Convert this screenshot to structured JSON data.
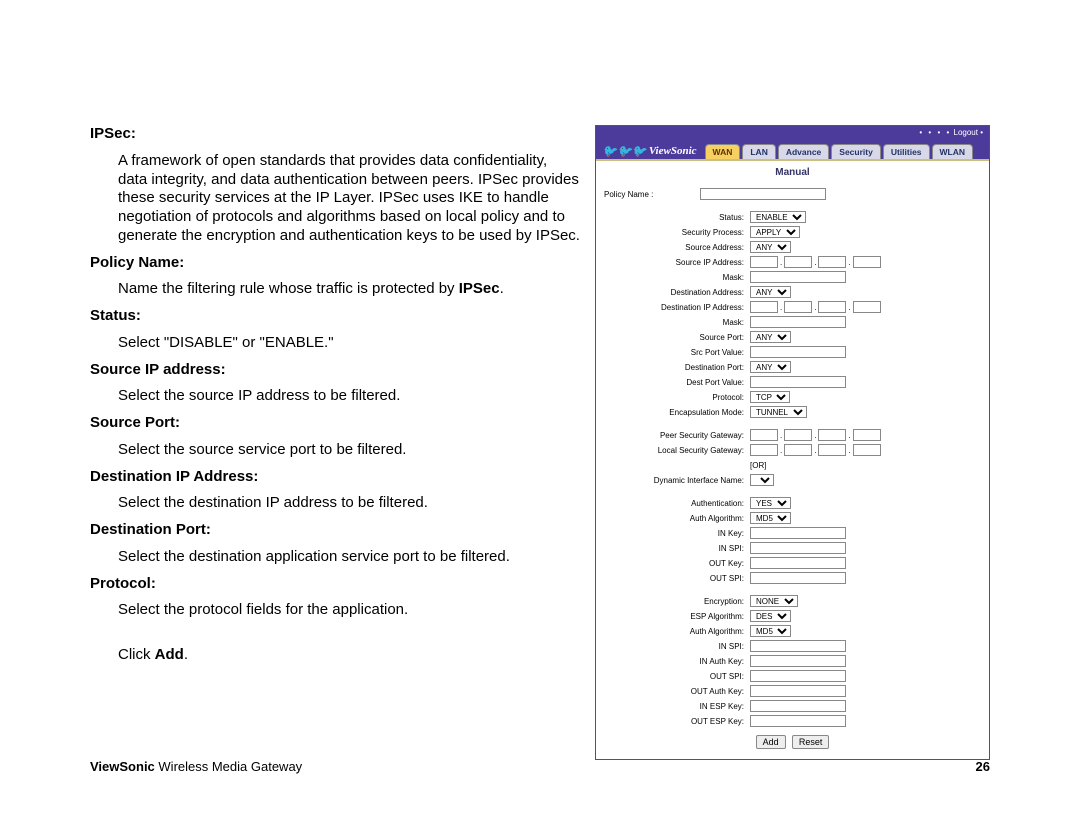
{
  "doc": {
    "sections": [
      {
        "heading": "IPSec:",
        "body": "A framework of open standards that provides data confidentiality, data integrity, and data authentication between peers.  IPSec provides these security services at the IP Layer.  IPSec uses IKE to handle negotiation of protocols and algorithms based on local policy and to generate the encryption and authentication keys to be used by IPSec."
      },
      {
        "heading": "Policy Name:",
        "body_pre": "Name the filtering rule whose traffic is protected by ",
        "body_bold": "IPSec",
        "body_post": "."
      },
      {
        "heading": "Status:",
        "body": "Select \"DISABLE\" or \"ENABLE.\""
      },
      {
        "heading": "Source IP address:",
        "body": "Select the source IP address to be filtered."
      },
      {
        "heading": "Source Port:",
        "body": "Select the source service port to be filtered."
      },
      {
        "heading": "Destination IP Address:",
        "body": "Select the destination IP address to be filtered."
      },
      {
        "heading": "Destination Port:",
        "body": "Select the destination application service port to be filtered."
      },
      {
        "heading": "Protocol:",
        "body": "Select the protocol fields for the application."
      }
    ],
    "click_pre": "Click ",
    "click_bold": "Add",
    "click_post": "."
  },
  "ui": {
    "logout": "Logout",
    "brand": "ViewSonic",
    "tabs": [
      "WAN",
      "LAN",
      "Advance",
      "Security",
      "Utilities",
      "WLAN"
    ],
    "title": "Manual",
    "policy_name_lbl": "Policy Name :",
    "rows1": [
      {
        "lbl": "Status:",
        "type": "select",
        "val": "ENABLE"
      },
      {
        "lbl": "Security Process:",
        "type": "select",
        "val": "APPLY"
      },
      {
        "lbl": "Source Address:",
        "type": "select",
        "val": "ANY"
      },
      {
        "lbl": "Source IP Address:",
        "type": "ip"
      },
      {
        "lbl": "Mask:",
        "type": "input_med"
      },
      {
        "lbl": "Destination Address:",
        "type": "select",
        "val": "ANY"
      },
      {
        "lbl": "Destination IP Address:",
        "type": "ip"
      },
      {
        "lbl": "Mask:",
        "type": "input_med"
      },
      {
        "lbl": "Source Port:",
        "type": "select",
        "val": "ANY"
      },
      {
        "lbl": "Src Port Value:",
        "type": "input_med"
      },
      {
        "lbl": "Destination Port:",
        "type": "select",
        "val": "ANY"
      },
      {
        "lbl": "Dest Port Value:",
        "type": "input_med"
      },
      {
        "lbl": "Protocol:",
        "type": "select",
        "val": "TCP"
      },
      {
        "lbl": "Encapsulation Mode:",
        "type": "select",
        "val": "TUNNEL"
      }
    ],
    "rows2": [
      {
        "lbl": "Peer Security Gateway:",
        "type": "ip"
      },
      {
        "lbl": "Local Security Gateway:",
        "type": "ip"
      },
      {
        "lbl": "",
        "type": "or",
        "val": "[OR]"
      },
      {
        "lbl": "Dynamic Interface Name:",
        "type": "select_blank"
      }
    ],
    "rows3": [
      {
        "lbl": "Authentication:",
        "type": "select",
        "val": "YES"
      },
      {
        "lbl": "Auth Algorithm:",
        "type": "select",
        "val": "MD5"
      },
      {
        "lbl": "IN Key:",
        "type": "input_med"
      },
      {
        "lbl": "IN SPI:",
        "type": "input_med"
      },
      {
        "lbl": "OUT Key:",
        "type": "input_med"
      },
      {
        "lbl": "OUT SPI:",
        "type": "input_med"
      }
    ],
    "rows4": [
      {
        "lbl": "Encryption:",
        "type": "select",
        "val": "NONE"
      },
      {
        "lbl": "ESP Algorithm:",
        "type": "select",
        "val": "DES"
      },
      {
        "lbl": "Auth Algorithm:",
        "type": "select",
        "val": "MD5"
      },
      {
        "lbl": "IN SPI:",
        "type": "input_med"
      },
      {
        "lbl": "IN Auth Key:",
        "type": "input_med"
      },
      {
        "lbl": "OUT SPI:",
        "type": "input_med"
      },
      {
        "lbl": "OUT Auth Key:",
        "type": "input_med"
      },
      {
        "lbl": "IN ESP Key:",
        "type": "input_med"
      },
      {
        "lbl": "OUT ESP Key:",
        "type": "input_med"
      }
    ],
    "buttons": [
      "Add",
      "Reset"
    ]
  },
  "footer": {
    "brand": "ViewSonic",
    "product": " Wireless Media Gateway",
    "page": "26"
  }
}
